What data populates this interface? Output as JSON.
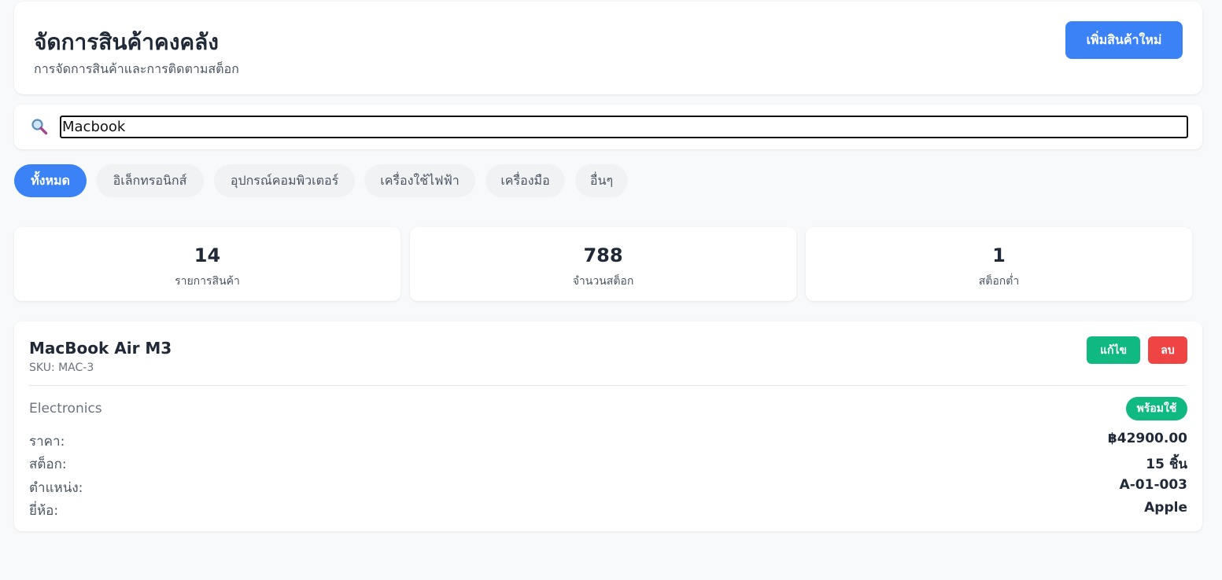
{
  "header": {
    "title": "จัดการสินค้าคงคลัง",
    "subtitle": "การจัดการสินค้าและการติดตามสต็อก",
    "add_button_label": "เพิ่มสินค้าใหม่"
  },
  "search": {
    "value": "Macbook",
    "icon": "search-icon"
  },
  "tabs": [
    {
      "label": "ทั้งหมด",
      "active": true
    },
    {
      "label": "อิเล็กทรอนิกส์",
      "active": false
    },
    {
      "label": "อุปกรณ์คอมพิวเตอร์",
      "active": false
    },
    {
      "label": "เครื่องใช้ไฟฟ้า",
      "active": false
    },
    {
      "label": "เครื่องมือ",
      "active": false
    },
    {
      "label": "อื่นๆ",
      "active": false
    }
  ],
  "stats": [
    {
      "value": "14",
      "label": "รายการสินค้า"
    },
    {
      "value": "788",
      "label": "จำนวนสต็อก"
    },
    {
      "value": "1",
      "label": "สต็อกต่ำ"
    }
  ],
  "product": {
    "name": "MacBook Air M3",
    "sku": "SKU: MAC-3",
    "edit_label": "แก้ไข",
    "delete_label": "ลบ",
    "category": "Electronics",
    "status": "พร้อมใช้",
    "details": [
      {
        "label": "ราคา:",
        "value": "฿42900.00"
      },
      {
        "label": "สต็อก:",
        "value": "15 ชิ้น"
      },
      {
        "label": "ตำแหน่ง:",
        "value": "A-01-003"
      },
      {
        "label": "ยี่ห้อ:",
        "value": "Apple"
      }
    ]
  },
  "colors": {
    "accent": "#3b82f6",
    "success": "#10b981",
    "danger": "#ef4444",
    "background": "#f8f9fb"
  }
}
